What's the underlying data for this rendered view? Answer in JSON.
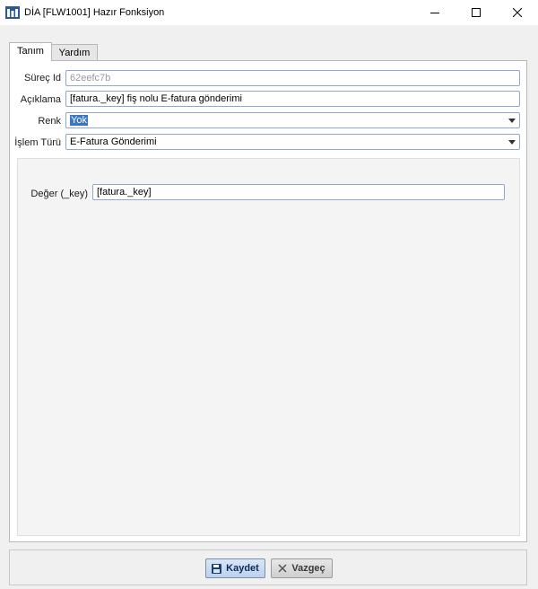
{
  "window": {
    "title": "DİA [FLW1001] Hazır Fonksiyon"
  },
  "tabs": [
    {
      "label": "Tanım",
      "active": true
    },
    {
      "label": "Yardım",
      "active": false
    }
  ],
  "form": {
    "surec_id": {
      "label": "Süreç Id",
      "value": "62eefc7b"
    },
    "aciklama": {
      "label": "Açıklama",
      "value": "[fatura._key] fiş nolu E-fatura gönderimi"
    },
    "renk": {
      "label": "Renk",
      "value": "Yok"
    },
    "islem_turu": {
      "label": "İşlem Türü",
      "value": "E-Fatura Gönderimi"
    }
  },
  "sub": {
    "deger": {
      "label": "Değer (_key)",
      "value": "[fatura._key]"
    }
  },
  "footer": {
    "save_label": "Kaydet",
    "cancel_label": "Vazgeç"
  },
  "colors": {
    "accent": "#3975c9",
    "field_border": "#8fa8cc"
  },
  "icons": {
    "app": "dia-logo-icon",
    "save": "floppy-disk-icon",
    "cancel": "x-icon"
  }
}
